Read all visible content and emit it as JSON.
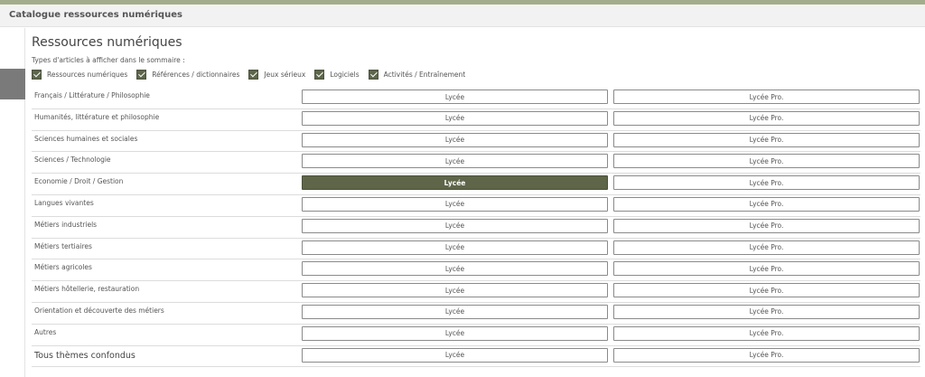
{
  "app": {
    "title": "Catalogue ressources numériques"
  },
  "page": {
    "title": "Ressources numériques",
    "filters_label": "Types d'articles à afficher dans le sommaire :"
  },
  "filters": [
    {
      "label": "Ressources numériques",
      "checked": true
    },
    {
      "label": "Références / dictionnaires",
      "checked": true
    },
    {
      "label": "Jeux sérieux",
      "checked": true
    },
    {
      "label": "Logiciels",
      "checked": true
    },
    {
      "label": "Activités / Entraînement",
      "checked": true
    }
  ],
  "themes": [
    {
      "label": "Français / Littérature / Philosophie",
      "lycee": "Lycée",
      "pro": "Lycée Pro."
    },
    {
      "label": "Humanités, littérature et philosophie",
      "lycee": "Lycée",
      "pro": "Lycée Pro."
    },
    {
      "label": "Sciences humaines et sociales",
      "lycee": "Lycée",
      "pro": "Lycée Pro."
    },
    {
      "label": "Sciences / Technologie",
      "lycee": "Lycée",
      "pro": "Lycée Pro."
    },
    {
      "label": "Economie / Droit / Gestion",
      "lycee": "Lycée",
      "pro": "Lycée Pro.",
      "active": "lycee"
    },
    {
      "label": "Langues vivantes",
      "lycee": "Lycée",
      "pro": "Lycée Pro."
    },
    {
      "label": "Métiers industriels",
      "lycee": "Lycée",
      "pro": "Lycée Pro."
    },
    {
      "label": "Métiers tertiaires",
      "lycee": "Lycée",
      "pro": "Lycée Pro."
    },
    {
      "label": "Métiers agricoles",
      "lycee": "Lycée",
      "pro": "Lycée Pro."
    },
    {
      "label": "Métiers hôtellerie, restauration",
      "lycee": "Lycée",
      "pro": "Lycée Pro."
    },
    {
      "label": "Orientation et découverte des métiers",
      "lycee": "Lycée",
      "pro": "Lycée Pro."
    },
    {
      "label": "Autres",
      "lycee": "Lycée",
      "pro": "Lycée Pro."
    },
    {
      "label": "Tous thèmes confondus",
      "lycee": "Lycée",
      "pro": "Lycée Pro."
    }
  ],
  "colors": {
    "accent": "#5e6548",
    "top_strip": "#a3ad8c"
  }
}
